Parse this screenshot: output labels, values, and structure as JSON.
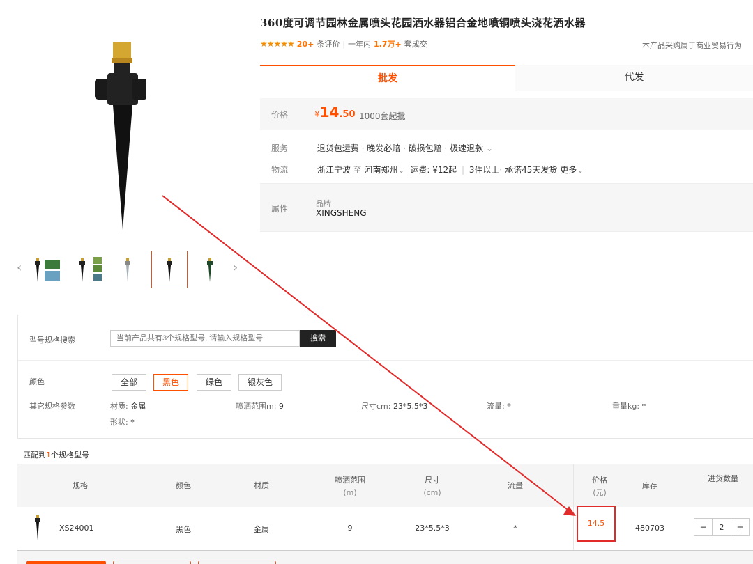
{
  "product": {
    "title": "360度可调节园林金属喷头花园洒水器铝合金地喷铜喷头浇花洒水器",
    "stars": "★★★★★",
    "review_count": "20+",
    "review_label": "条评价",
    "sep": "|",
    "year_label": "一年内",
    "sold_count": "1.7万+",
    "sold_label": "套成交",
    "biz_note": "本产品采购属于商业贸易行为"
  },
  "tabs": {
    "wholesale": "批发",
    "dropship": "代发"
  },
  "price": {
    "label": "价格",
    "currency": "¥",
    "integer": "14",
    "decimal": ".50",
    "min_batch": "1000套起批"
  },
  "service": {
    "label": "服务",
    "text": "退货包运费 · 晚发必赔 · 破损包赔 · 极速退款"
  },
  "logistics": {
    "label": "物流",
    "from": "浙江宁波",
    "to_word": "至",
    "to": "河南郑州",
    "freight": "运费: ¥12起",
    "promise": "3件以上· 承诺45天发货",
    "more": "更多"
  },
  "attributes": {
    "label": "属性",
    "brand_label": "品牌",
    "brand": "XINGSHENG"
  },
  "spec_search": {
    "label": "型号规格搜索",
    "placeholder": "当前产品共有3个规格型号, 请输入规格型号",
    "button": "搜索"
  },
  "colors": {
    "label": "颜色",
    "options": [
      "全部",
      "黑色",
      "绿色",
      "银灰色"
    ],
    "selected": "黑色"
  },
  "other_params": {
    "label": "其它规格参数",
    "material_label": "材质:",
    "material": "金属",
    "range_label": "喷洒范围m:",
    "range": "9",
    "size_label": "尺寸cm:",
    "size": "23*5.5*3",
    "flow_label": "流量:",
    "flow": "*",
    "weight_label": "重量kg:",
    "weight": "*",
    "shape_label": "形状:",
    "shape": "*"
  },
  "matched": {
    "prefix": "匹配到",
    "count": "1",
    "suffix": "个规格型号"
  },
  "table": {
    "headers": {
      "spec": "规格",
      "color": "颜色",
      "material": "材质",
      "range": "喷洒范围",
      "range_unit": "(m)",
      "size": "尺寸",
      "size_unit": "(cm)",
      "flow": "流量",
      "price": "价格",
      "price_unit": "(元)",
      "stock": "库存",
      "qty": "进货数量"
    },
    "rows": [
      {
        "spec": "XS24001",
        "color": "黑色",
        "material": "金属",
        "range": "9",
        "size": "23*5.5*3",
        "flow": "*",
        "price": "14.5",
        "stock": "480703",
        "qty": "2"
      }
    ]
  },
  "stepper": {
    "minus": "−",
    "plus": "+"
  },
  "colors_theme": {
    "accent": "#ff5000",
    "highlight": "#e12b2b",
    "star": "#f28c00"
  }
}
